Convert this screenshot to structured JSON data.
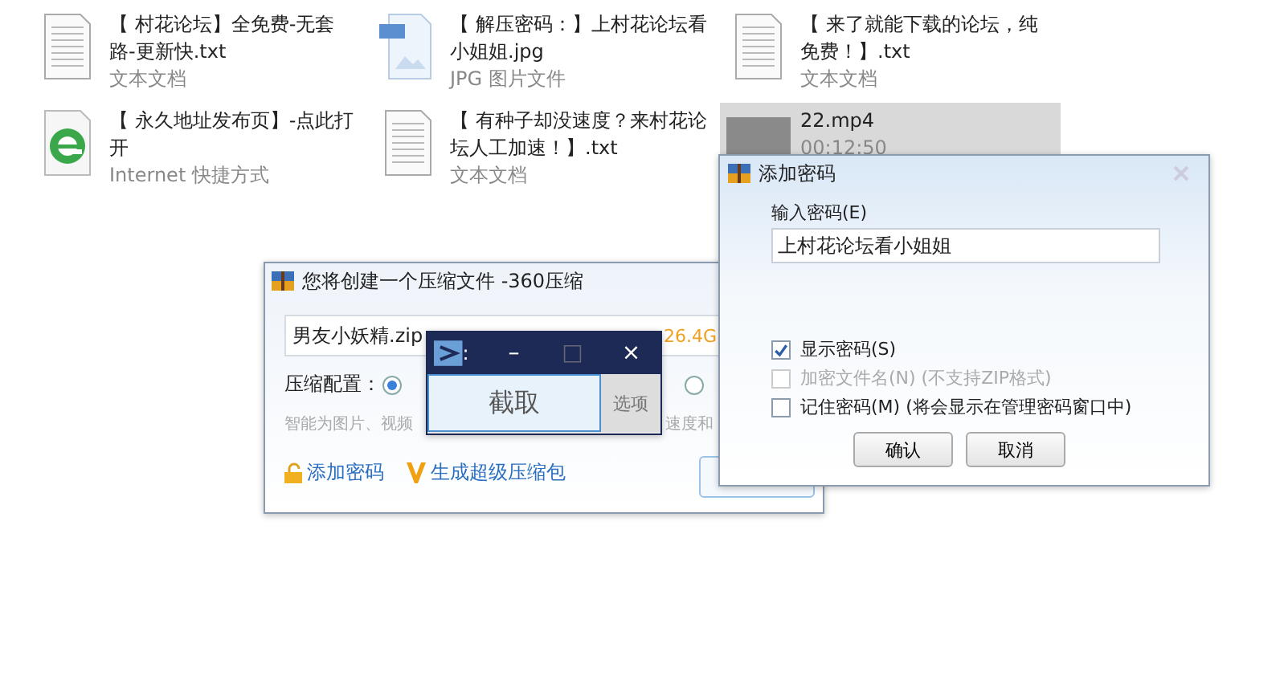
{
  "files": [
    {
      "kind": "text",
      "name": "【 村花论坛】全免费-无套路-更新快.txt",
      "type": "文本文档",
      "selected": false
    },
    {
      "kind": "jpg",
      "name": "【 解压密码：】上村花论坛看小姐姐.jpg",
      "type": "JPG 图片文件",
      "selected": false
    },
    {
      "kind": "text",
      "name": "【 来了就能下载的论坛，纯免费！】.txt",
      "type": "文本文档",
      "selected": false
    },
    {
      "kind": "shortcut",
      "name": "【 永久地址发布页】-点此打开",
      "type": "Internet 快捷方式",
      "selected": false
    },
    {
      "kind": "text",
      "name": "【 有种子却没速度？来村花论坛人工加速！】.txt",
      "type": "文本文档",
      "selected": false
    },
    {
      "kind": "video",
      "name": "22.mp4",
      "type": "00:12:50",
      "selected": true
    }
  ],
  "compress_dialog": {
    "title": "您将创建一个压缩文件 -360压缩",
    "filename": "男友小妖精.zip",
    "free_space": "26.4G",
    "config_label": "压缩配置：",
    "options": [
      {
        "selected": true
      },
      {
        "selected": false
      }
    ],
    "hint_left": "智能为图片、视频",
    "hint_right": "速度和",
    "add_password": "添加密码",
    "super_package": "生成超级压缩包"
  },
  "capture_window": {
    "title": ":",
    "minimize": "–",
    "maximize": "□",
    "close": "×",
    "capture_button": "截取",
    "options_button": "选项"
  },
  "password_dialog": {
    "title": "添加密码",
    "password_label": "输入密码(E)",
    "password": "上村花论坛看小姐姐",
    "checkboxes": [
      {
        "label": "显示密码(S)",
        "checked": true,
        "disabled": false
      },
      {
        "label": "加密文件名(N) (不支持ZIP格式)",
        "checked": false,
        "disabled": true
      },
      {
        "label": "记住密码(M) (将会显示在管理密码窗口中)",
        "checked": false,
        "disabled": false
      }
    ],
    "buttons": [
      "确认",
      "取消"
    ]
  }
}
